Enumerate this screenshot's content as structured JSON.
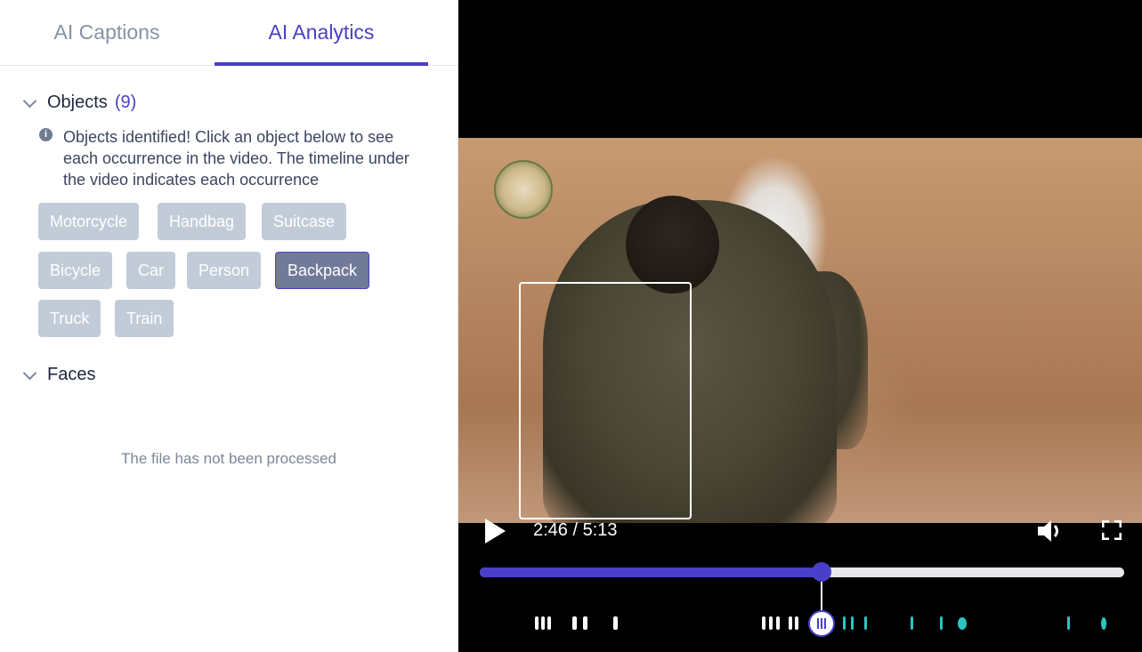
{
  "tabs": [
    {
      "label": "AI Captions",
      "active": false
    },
    {
      "label": "AI Analytics",
      "active": true
    }
  ],
  "objects": {
    "title": "Objects",
    "count_text": "(9)",
    "info": "Objects identified! Click an object below to see each occurrence in the video. The timeline under the video indicates each occurrence",
    "items": [
      {
        "label": "Motorcycle",
        "selected": false
      },
      {
        "label": "Handbag",
        "selected": false
      },
      {
        "label": "Suitcase",
        "selected": false
      },
      {
        "label": "Bicycle",
        "selected": false
      },
      {
        "label": "Car",
        "selected": false
      },
      {
        "label": "Person",
        "selected": false
      },
      {
        "label": "Backpack",
        "selected": true
      },
      {
        "label": "Truck",
        "selected": false
      },
      {
        "label": "Train",
        "selected": false
      }
    ]
  },
  "faces": {
    "title": "Faces",
    "empty_message": "The file has not been processed"
  },
  "player": {
    "time_display": "2:46 / 5:13",
    "progress_fraction": 0.53,
    "play_icon": "play-icon",
    "volume_icon": "volume-icon",
    "fullscreen_icon": "fullscreen-icon"
  },
  "colors": {
    "accent": "#4a3fc8",
    "chip_bg": "#c2ccd8",
    "chip_selected_bg": "#717a98",
    "occurrence_marker": "#ffffff",
    "occurrence_marker_other": "#2bc4c1"
  }
}
